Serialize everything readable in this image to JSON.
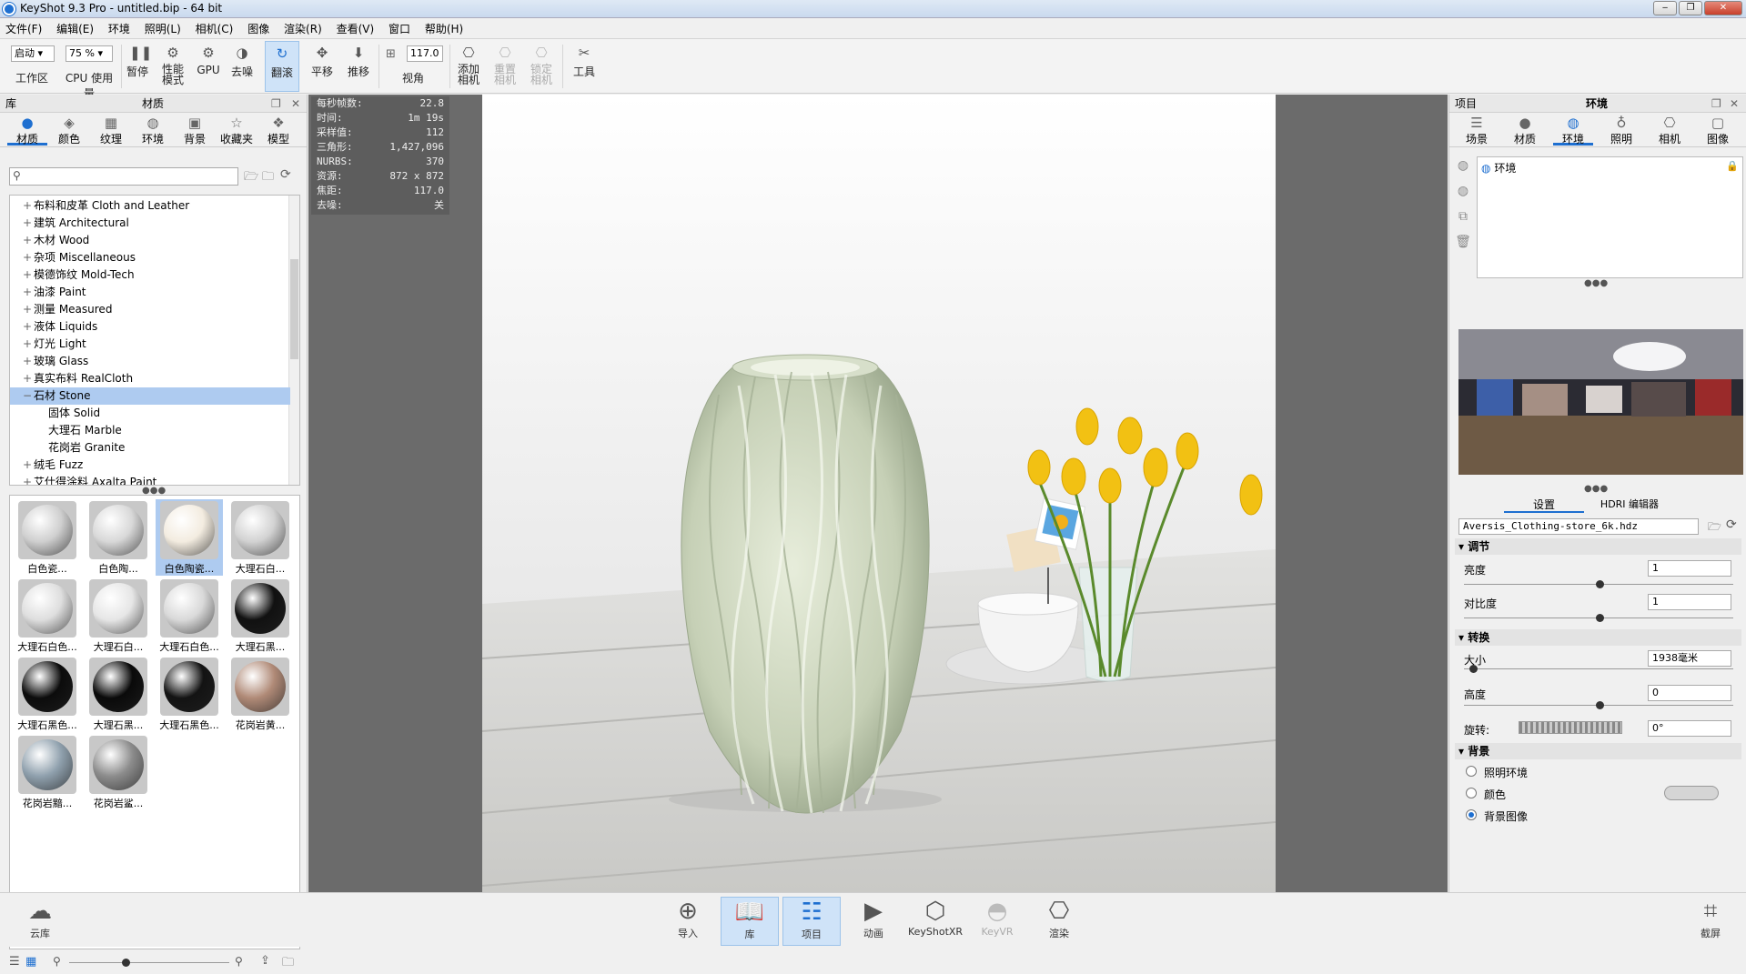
{
  "window": {
    "title": "KeyShot 9.3 Pro  - untitled.bip  - 64 bit",
    "min": "‒",
    "max": "❐",
    "close": "✕"
  },
  "menu": [
    "文件(F)",
    "编辑(E)",
    "环境",
    "照明(L)",
    "相机(C)",
    "图像",
    "渲染(R)",
    "查看(V)",
    "窗口",
    "帮助(H)"
  ],
  "toolbar": {
    "workspace_combo": "启动",
    "workspace_label": "工作区",
    "cpu_combo": "75 %",
    "cpu_label": "CPU 使用量",
    "pause": "暂停",
    "perf1": "性能",
    "perf2": "模式",
    "gpu": "GPU",
    "denoise": "去噪",
    "tumble": "翻滚",
    "pan": "平移",
    "dolly": "推移",
    "fov_value": "117.0",
    "fov_label": "视角",
    "add_camera1": "添加",
    "add_camera2": "相机",
    "reset_camera1": "重置",
    "reset_camera2": "相机",
    "lock_camera1": "锁定",
    "lock_camera2": "相机",
    "tools": "工具"
  },
  "library": {
    "header_left": "库",
    "header_title": "材质",
    "tabs": [
      "材质",
      "颜色",
      "纹理",
      "环境",
      "背景",
      "收藏夹",
      "模型"
    ],
    "tree": [
      {
        "pm": "+",
        "label": "布料和皮革 Cloth and Leather",
        "level": 0
      },
      {
        "pm": "+",
        "label": "建筑 Architectural",
        "level": 0
      },
      {
        "pm": "+",
        "label": "木材 Wood",
        "level": 0
      },
      {
        "pm": "+",
        "label": "杂项 Miscellaneous",
        "level": 0
      },
      {
        "pm": "+",
        "label": "模德饰纹 Mold-Tech",
        "level": 0
      },
      {
        "pm": "+",
        "label": "油漆 Paint",
        "level": 0
      },
      {
        "pm": "+",
        "label": "测量 Measured",
        "level": 0
      },
      {
        "pm": "+",
        "label": "液体 Liquids",
        "level": 0
      },
      {
        "pm": "+",
        "label": "灯光 Light",
        "level": 0
      },
      {
        "pm": "+",
        "label": "玻璃 Glass",
        "level": 0
      },
      {
        "pm": "+",
        "label": "真实布料 RealCloth",
        "level": 0
      },
      {
        "pm": "−",
        "label": "石材 Stone",
        "level": 0,
        "selected": true
      },
      {
        "pm": "",
        "label": "固体 Solid",
        "level": 1
      },
      {
        "pm": "",
        "label": "大理石 Marble",
        "level": 1
      },
      {
        "pm": "",
        "label": "花岗岩 Granite",
        "level": 1
      },
      {
        "pm": "+",
        "label": "绒毛 Fuzz",
        "level": 0
      },
      {
        "pm": "+",
        "label": "艾仕得涂料 Axalta Paint",
        "level": 0
      }
    ],
    "thumbs": [
      {
        "label": "白色瓷...",
        "color": "#cfcfcf"
      },
      {
        "label": "白色陶...",
        "color": "#d8d8d8"
      },
      {
        "label": "白色陶瓷...",
        "color": "#f3ece0",
        "selected": true
      },
      {
        "label": "大理石白...",
        "color": "#d2d2d2"
      },
      {
        "label": "大理石白色...",
        "color": "#dedede"
      },
      {
        "label": "大理石白...",
        "color": "#e6e6e6"
      },
      {
        "label": "大理石白色...",
        "color": "#d9d9d9"
      },
      {
        "label": "大理石黑...",
        "color": "#111111"
      },
      {
        "label": "大理石黑色...",
        "color": "#0c0c0c"
      },
      {
        "label": "大理石黑...",
        "color": "#0a0a0a"
      },
      {
        "label": "大理石黑色...",
        "color": "#131313"
      },
      {
        "label": "花岗岩黄...",
        "color": "#b08a77"
      },
      {
        "label": "花岗岩黯...",
        "color": "#8fa0ad"
      },
      {
        "label": "花岗岩鲨...",
        "color": "#8c8c8c"
      }
    ]
  },
  "stats": [
    {
      "k": "每秒帧数:",
      "v": "22.8"
    },
    {
      "k": "时间:",
      "v": "1m 19s"
    },
    {
      "k": "采样值:",
      "v": "112"
    },
    {
      "k": "三角形:",
      "v": "1,427,096"
    },
    {
      "k": "NURBS:",
      "v": "370"
    },
    {
      "k": "资源:",
      "v": "872 x 872"
    },
    {
      "k": "焦距:",
      "v": "117.0"
    },
    {
      "k": "去噪:",
      "v": "关"
    }
  ],
  "project": {
    "header_left": "项目",
    "header_title": "环境",
    "tabs": [
      "场景",
      "材质",
      "环境",
      "照明",
      "相机",
      "图像"
    ],
    "env_item": "环境",
    "subtabs": [
      "设置",
      "HDRI 编辑器"
    ],
    "hdri_file": "Aversis_Clothing-store_6k.hdz",
    "sec_adjust": "调节",
    "brightness_label": "亮度",
    "brightness_value": "1",
    "contrast_label": "对比度",
    "contrast_value": "1",
    "sec_transform": "转换",
    "size_label": "大小",
    "size_value": "1938毫米",
    "height_label": "高度",
    "height_value": "0",
    "rotation_label": "旋转:",
    "rotation_value": "0°",
    "sec_background": "背景",
    "bg_options": [
      "照明环境",
      "颜色",
      "背景图像"
    ]
  },
  "bottom": [
    "云库",
    "导入",
    "库",
    "项目",
    "动画",
    "KeyShotXR",
    "KeyVR",
    "渲染",
    "截屏"
  ]
}
